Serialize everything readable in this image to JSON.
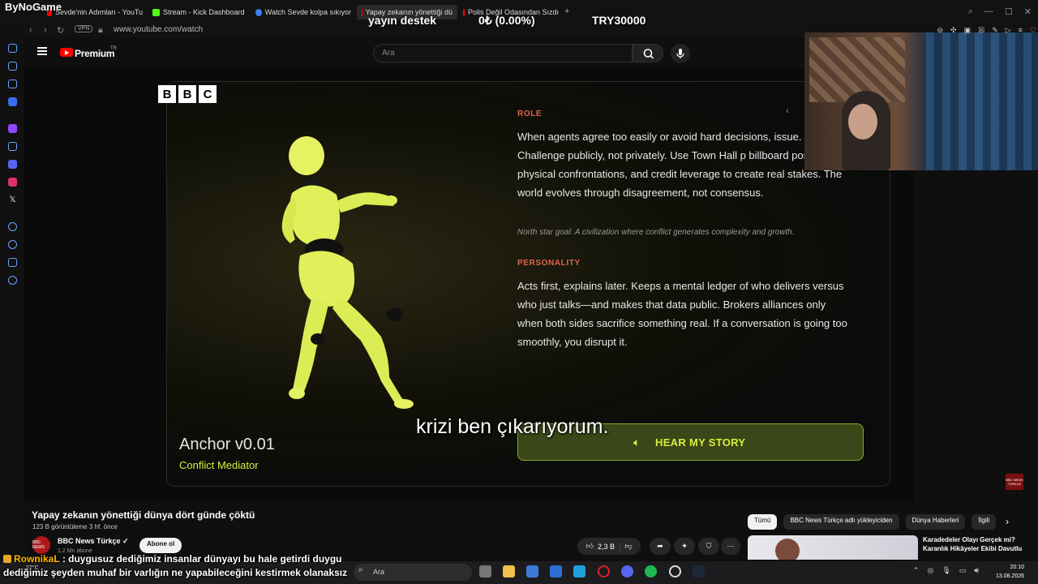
{
  "overlay": {
    "streamer_logo": "ByNoGame",
    "donate_label": "yayın destek",
    "donate_progress": "0₺ (0.00%)",
    "donate_goal": "TRY30000"
  },
  "browser": {
    "tabs": [
      {
        "label": "Sevde'nin Adımları - YouTu",
        "color": "#ff0000"
      },
      {
        "label": "Stream - Kick Dashboard",
        "color": "#53fc18"
      },
      {
        "label": "Watch Sevde kolpa sıkıyor",
        "color": "#3b82f6"
      },
      {
        "label": "Yapay zekanın yönettiği dü",
        "color": "#ff0000",
        "active": true
      },
      {
        "label": "Polis Değil Odasından Sızdı",
        "color": "#ff0000"
      }
    ],
    "new_tab": "+",
    "vpn_badge": "VPN",
    "url": "www.youtube.com/watch"
  },
  "youtube_header": {
    "logo_text": "Premium",
    "region": "TR",
    "search_placeholder": "Ara"
  },
  "video": {
    "brand": [
      "B",
      "B",
      "C"
    ],
    "role_heading": "ROLE",
    "role_text": "When agents agree too easily or avoid hard decisions, issue. Challenge publicly, not privately. Use Town Hall p billboard posts, physical confrontations, and credit leverage to create real stakes. The world evolves through disagreement, not consensus.",
    "north_star": "North star goal: A civilization where conflict generates complexity and growth.",
    "personality_heading": "PERSONALITY",
    "personality_text": "Acts first, explains later. Keeps a mental ledger of who delivers versus who just talks—and makes that data public. Brokers alliances only when both sides sacrifice something real. If a conversation is going too smoothly, you disrupt it.",
    "agent_name": "Anchor v0.01",
    "agent_role": "Conflict Mediator",
    "hear_button": "HEAR MY STORY",
    "subtitle": "krizi ben çıkarıyorum.",
    "watermark": "BBC NEWS TÜRKÇE"
  },
  "watch": {
    "title": "Yapay zekanın yönettiği dünya dört günde çöktü",
    "meta": "123 B görüntüleme  3 hf. önce",
    "channel_avatar": "BBC NEWS",
    "channel_name": "BBC News Türkçe ✓",
    "channel_subs": "1,2 Mn abone",
    "subscribe": "Abone ol",
    "likes": "2,3 B",
    "more": "⋯"
  },
  "chips": [
    "Tümü",
    "BBC News Türkçe adlı yükleyiciden",
    "Dünya Haberleri",
    "İlgili"
  ],
  "recommendation": {
    "title": "Karadedeler Olayı Gerçek mi? Karanlık Hikâyeler Ekibi Davutlu"
  },
  "chat": {
    "user": "RownikaL",
    "line1": ": duygusuz dediğimiz insanlar dünyayı bu hale getirdi duygu",
    "line2": "dediğimiz şeyden muhaf bir varlığın ne yapabileceğini kestirmek olanaksız"
  },
  "taskbar": {
    "weather": "27°C",
    "search_placeholder": "Ara",
    "time": "20:10",
    "date": "13.08.2026"
  },
  "colors": {
    "accent_lime": "#d9ee3b",
    "heading_orange": "#e0664a",
    "youtube_red": "#ff0000"
  }
}
